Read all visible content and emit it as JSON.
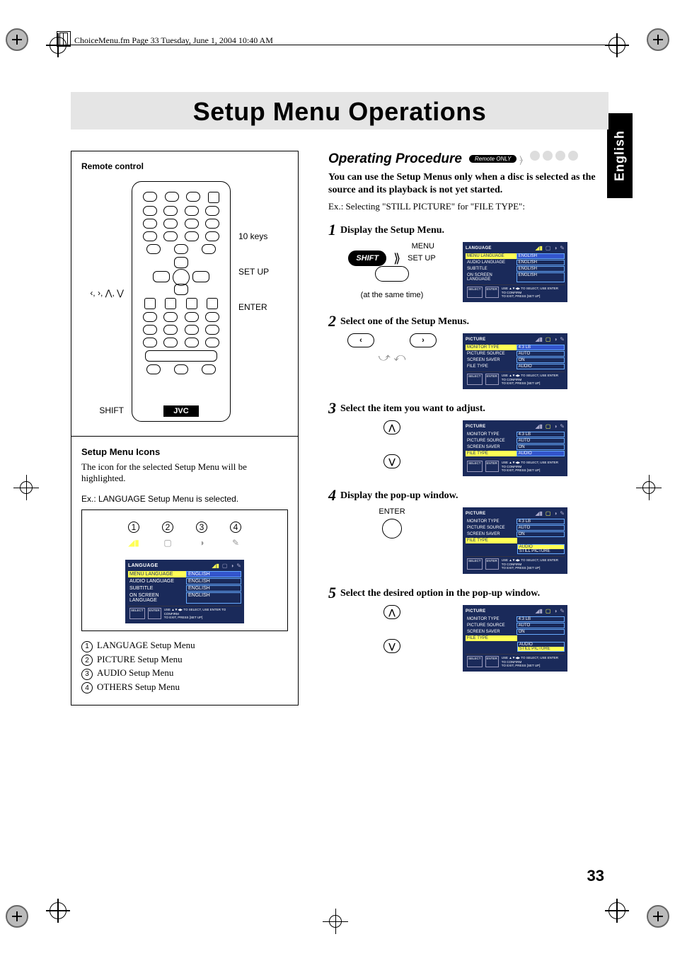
{
  "header_line": "ChoiceMenu.fm  Page 33  Tuesday, June 1, 2004  10:40 AM",
  "side_tab": "English",
  "title": "Setup Menu Operations",
  "page_number": "33",
  "remote": {
    "heading": "Remote control",
    "label_keys10": "10 keys",
    "label_setup": "SET UP",
    "label_enter": "ENTER",
    "label_dpad": "‹, ›, ⋀, ⋁",
    "label_shift": "SHIFT",
    "logo": "JVC"
  },
  "left_section2": {
    "heading": "Setup Menu Icons",
    "body": "The icon for the selected Setup Menu will be highlighted.",
    "example": "Ex.: LANGUAGE Setup Menu is selected.",
    "legend": [
      "LANGUAGE Setup Menu",
      "PICTURE Setup Menu",
      "AUDIO Setup Menu",
      "OTHERS Setup Menu"
    ]
  },
  "lang_menu": {
    "title": "LANGUAGE",
    "rows": [
      {
        "label": "MENU LANGUAGE",
        "value": "ENGLISH"
      },
      {
        "label": "AUDIO LANGUAGE",
        "value": "ENGLISH"
      },
      {
        "label": "SUBTITLE",
        "value": "ENGLISH"
      },
      {
        "label": "ON SCREEN LANGUAGE",
        "value": "ENGLISH"
      }
    ],
    "footer_select": "SELECT",
    "footer_enter": "ENTER",
    "footer_text": "USE ▲▼◀▶ TO SELECT,  USE ENTER TO CONFIRM",
    "footer_text2": "TO EXIT, PRESS [SET UP]"
  },
  "pic_menu": {
    "title": "PICTURE",
    "rows": [
      {
        "label": "MONITOR TYPE",
        "value": "4:3 LB"
      },
      {
        "label": "PICTURE SOURCE",
        "value": "AUTO"
      },
      {
        "label": "SCREEN SAVER",
        "value": "ON"
      },
      {
        "label": "FILE TYPE",
        "value": "AUDIO"
      }
    ]
  },
  "popup_options": [
    "AUDIO",
    "STILL PICTURE"
  ],
  "ops": {
    "heading": "Operating Procedure",
    "badge": "Remote ONLY",
    "intro_bold": "You can use the Setup Menus only when a disc is selected as the source and its playback is not yet started.",
    "intro_ex": "Ex.: Selecting \"STILL PICTURE\" for \"FILE TYPE\":",
    "steps": [
      {
        "num": "1",
        "text": "Display the Setup Menu.",
        "diag_shift": "SHIFT",
        "diag_menu": "MENU",
        "diag_setup": "SET UP",
        "diag_note": "(at the same time)",
        "screen": "lang"
      },
      {
        "num": "2",
        "text": "Select one of the Setup Menus.",
        "screen": "pic"
      },
      {
        "num": "3",
        "text": "Select the item you want to adjust.",
        "screen": "pic_hl"
      },
      {
        "num": "4",
        "text": "Display the pop-up window.",
        "diag_enter": "ENTER",
        "screen": "pic_popup1"
      },
      {
        "num": "5",
        "text": "Select the desired option in the pop-up window.",
        "screen": "pic_popup2"
      }
    ]
  }
}
